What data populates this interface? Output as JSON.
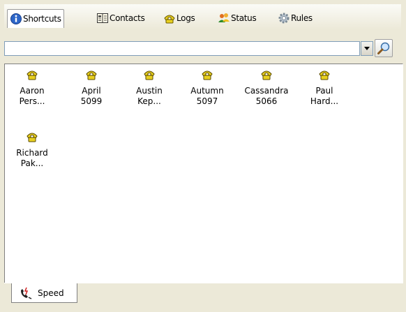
{
  "tabs": [
    {
      "label": "Shortcuts",
      "icon": "info-icon",
      "active": true
    },
    {
      "label": "Contacts",
      "icon": "address-book-icon"
    },
    {
      "label": "Logs",
      "icon": "phone-log-icon"
    },
    {
      "label": "Status",
      "icon": "people-status-icon"
    },
    {
      "label": "Rules",
      "icon": "gear-icon"
    }
  ],
  "search": {
    "value": "",
    "placeholder": ""
  },
  "shortcuts": [
    {
      "line1": "Aaron",
      "line2": "Pers...",
      "icon": "phone-icon"
    },
    {
      "line1": "April",
      "line2": "5099",
      "icon": "phone-icon"
    },
    {
      "line1": "Austin",
      "line2": "Kep...",
      "icon": "phone-icon"
    },
    {
      "line1": "Autumn",
      "line2": "5097",
      "icon": "phone-icon"
    },
    {
      "line1": "Cassandra",
      "line2": "5066",
      "icon": "phone-icon"
    },
    {
      "line1": "Paul",
      "line2": "Hard...",
      "icon": "phone-icon"
    },
    {
      "line1": "Richard",
      "line2": "Pak...",
      "icon": "phone-icon"
    }
  ],
  "bottom_tab": {
    "label": "Speed",
    "icon": "speed-dial-icon"
  },
  "colors": {
    "phone_icon": "#e8d020",
    "accent_blue": "#2060c0"
  }
}
